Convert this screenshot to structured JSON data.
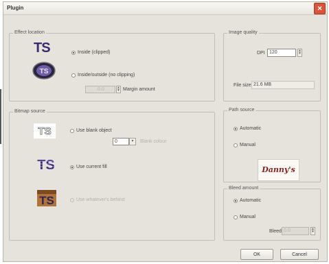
{
  "window": {
    "title": "Plugin",
    "close_glyph": "×"
  },
  "effect_location": {
    "legend": "Effect location",
    "inside_label": "Inside (clipped)",
    "inside_outside_label": "Inside/outside (no clipping)",
    "margin_value": "0.0",
    "margin_label": "Margin amount",
    "selected": "inside"
  },
  "bitmap_source": {
    "legend": "Bitmap source",
    "use_blank_label": "Use blank object",
    "blank_value": "0",
    "blank_dim_label": "Blank colour",
    "use_current_fill_label": "Use current fill",
    "use_underneath_label": "Use whatever's behind",
    "selected": "use_current_fill"
  },
  "image_quality": {
    "legend": "Image quality",
    "dpi_label": "DPI",
    "dpi_value": "120",
    "file_size_label": "File size",
    "file_size_value": "21.6 MB"
  },
  "path_source": {
    "legend": "Path source",
    "automatic_label": "Automatic",
    "manual_label": "Manual",
    "selected": "automatic",
    "preview_text": "Danny's"
  },
  "bleed_amount": {
    "legend": "Bleed amount",
    "automatic_label": "Automatic",
    "manual_label": "Manual",
    "bleed_label": "Bleed",
    "bleed_value": "0.0",
    "selected": "automatic"
  },
  "buttons": {
    "ok": "OK",
    "cancel": "Cancel"
  },
  "icons": {
    "ts_text": "TS"
  },
  "colors": {
    "close": "#d9533d",
    "ts_purple": "#3a2a6d",
    "preview_red": "#8a1f1a"
  }
}
